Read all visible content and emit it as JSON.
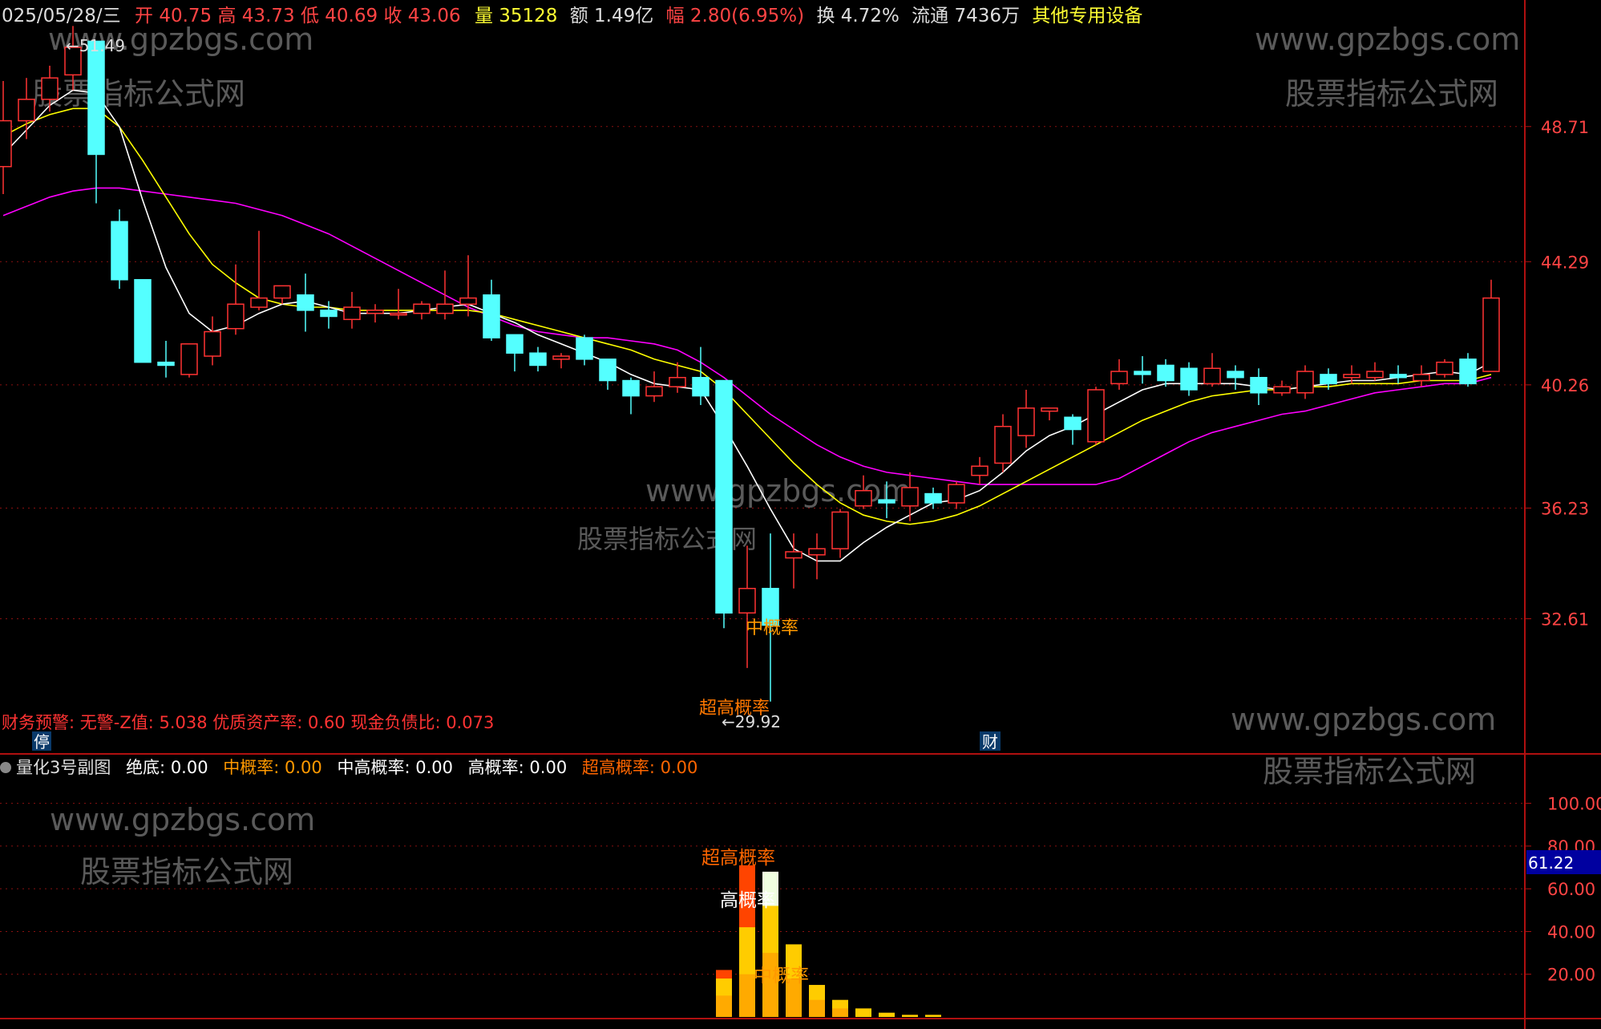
{
  "header": {
    "date": "025/05/28/三",
    "open_label": "开",
    "open": "40.75",
    "high_label": "高",
    "high": "43.73",
    "low_label": "低",
    "low": "40.69",
    "close_label": "收",
    "close": "43.06",
    "volume_label": "量",
    "volume": "35128",
    "amount_label": "额",
    "amount": "1.49亿",
    "change_label": "幅",
    "change": "2.80(6.95%)",
    "turnover_label": "换",
    "turnover": "4.72%",
    "float_label": "流通",
    "float": "7436万",
    "industry": "其他专用设备"
  },
  "watermarks": {
    "url": "www.gpzbgs.com",
    "cn": "股票指标公式网",
    "center_url": "www.gpzbgs.com",
    "center_cn": "股票指标公式网"
  },
  "main": {
    "max_label": "51.49",
    "min_label": "29.92",
    "finance_warning": "财务预警: 无警-Z值: 5.038 优质资产率: 0.60 现金负债比: 0.073",
    "tag_stop": "停",
    "tag_finance": "财",
    "annotation_mid": "中概率",
    "annotation_super": "超高概率"
  },
  "sub": {
    "title": "量化3号副图",
    "legend": [
      {
        "label": "绝底: 0.00",
        "color": "#ffffff"
      },
      {
        "label": "中概率: 0.00",
        "color": "#ff9900"
      },
      {
        "label": "中高概率: 0.00",
        "color": "#ffffff"
      },
      {
        "label": "高概率: 0.00",
        "color": "#ffffff"
      },
      {
        "label": "超高概率: 0.00",
        "color": "#ff6600"
      }
    ],
    "annotation_super": "超高概率",
    "annotation_high": "高概率",
    "annotation_mid": "中概率",
    "current_value": "61.22"
  },
  "chart_data": [
    {
      "type": "candlestick",
      "price_axis_ticks": [
        48.71,
        44.29,
        40.26,
        36.23,
        32.61
      ],
      "y_range": [
        29.5,
        51.8
      ],
      "moving_average_colors": {
        "ma_fast": "#ffffff",
        "ma_mid": "#ffff00",
        "ma_slow": "#ff00ff"
      },
      "up_color": "#ff3333",
      "down_color": "#54ffff",
      "candles": [
        [
          47.4,
          48.9,
          46.5,
          50.2
        ],
        [
          48.9,
          49.6,
          48.3,
          50.3
        ],
        [
          49.6,
          50.3,
          49.2,
          50.7
        ],
        [
          50.4,
          51.3,
          49.9,
          52.0
        ],
        [
          51.5,
          47.8,
          46.2,
          51.5
        ],
        [
          45.6,
          43.7,
          43.4,
          46.0
        ],
        [
          43.7,
          41.0,
          41.0,
          43.7
        ],
        [
          41.0,
          40.9,
          40.5,
          41.7
        ],
        [
          40.6,
          41.6,
          40.5,
          41.6
        ],
        [
          41.2,
          42.0,
          40.9,
          42.5
        ],
        [
          42.1,
          42.9,
          41.9,
          44.2
        ],
        [
          42.8,
          43.1,
          42.7,
          45.3
        ],
        [
          43.1,
          43.5,
          42.9,
          43.5
        ],
        [
          43.2,
          42.7,
          42.0,
          43.9
        ],
        [
          42.7,
          42.5,
          42.1,
          43.0
        ],
        [
          42.4,
          42.8,
          42.1,
          43.3
        ],
        [
          42.6,
          42.7,
          42.3,
          42.9
        ],
        [
          42.6,
          42.6,
          42.4,
          43.4
        ],
        [
          42.6,
          42.9,
          42.4,
          43.0
        ],
        [
          42.6,
          42.9,
          42.4,
          44.0
        ],
        [
          42.9,
          43.1,
          42.5,
          44.5
        ],
        [
          43.2,
          41.8,
          41.7,
          43.7
        ],
        [
          41.9,
          41.3,
          40.7,
          41.9
        ],
        [
          41.3,
          40.9,
          40.7,
          41.5
        ],
        [
          41.1,
          41.2,
          40.8,
          41.3
        ],
        [
          41.8,
          41.1,
          40.9,
          41.9
        ],
        [
          41.1,
          40.4,
          40.1,
          41.1
        ],
        [
          40.4,
          39.9,
          39.3,
          40.5
        ],
        [
          39.9,
          40.2,
          39.7,
          40.7
        ],
        [
          40.2,
          40.5,
          40.0,
          41.0
        ],
        [
          40.5,
          39.9,
          39.6,
          41.5
        ],
        [
          40.4,
          32.8,
          32.3,
          40.4
        ],
        [
          32.8,
          33.6,
          31.0,
          35.0
        ],
        [
          33.6,
          32.4,
          29.9,
          35.4
        ],
        [
          34.6,
          34.8,
          33.6,
          35.4
        ],
        [
          34.7,
          34.9,
          33.9,
          35.4
        ],
        [
          34.9,
          36.1,
          34.6,
          36.2
        ],
        [
          36.3,
          36.8,
          36.2,
          37.3
        ],
        [
          36.5,
          36.4,
          35.9,
          37.1
        ],
        [
          36.3,
          36.9,
          35.8,
          37.4
        ],
        [
          36.7,
          36.4,
          36.2,
          36.9
        ],
        [
          36.4,
          37.0,
          36.2,
          37.1
        ],
        [
          37.3,
          37.6,
          37.0,
          37.9
        ],
        [
          37.7,
          38.9,
          37.4,
          39.3
        ],
        [
          38.6,
          39.5,
          38.2,
          40.1
        ],
        [
          39.4,
          39.5,
          39.1,
          39.5
        ],
        [
          39.2,
          38.8,
          38.3,
          39.3
        ],
        [
          38.4,
          40.1,
          38.3,
          40.2
        ],
        [
          40.3,
          40.7,
          40.1,
          41.1
        ],
        [
          40.7,
          40.6,
          40.3,
          41.2
        ],
        [
          40.9,
          40.4,
          40.2,
          41.1
        ],
        [
          40.8,
          40.1,
          39.9,
          41.0
        ],
        [
          40.3,
          40.8,
          40.2,
          41.3
        ],
        [
          40.7,
          40.5,
          40.1,
          40.9
        ],
        [
          40.5,
          40.0,
          39.6,
          40.8
        ],
        [
          40.0,
          40.2,
          39.9,
          40.4
        ],
        [
          40.0,
          40.7,
          39.8,
          40.9
        ],
        [
          40.6,
          40.3,
          40.1,
          40.8
        ],
        [
          40.5,
          40.6,
          40.3,
          40.9
        ],
        [
          40.5,
          40.7,
          40.4,
          41.0
        ],
        [
          40.6,
          40.5,
          40.3,
          40.9
        ],
        [
          40.4,
          40.6,
          40.2,
          40.9
        ],
        [
          40.6,
          41.0,
          40.5,
          41.1
        ],
        [
          41.1,
          40.3,
          40.2,
          41.3
        ],
        [
          40.7,
          43.1,
          40.7,
          43.7
        ]
      ],
      "ma_fast": [
        47.8,
        48.6,
        49.4,
        49.9,
        49.8,
        48.7,
        46.3,
        44.1,
        42.6,
        42.0,
        42.2,
        42.6,
        42.9,
        43.0,
        42.8,
        42.6,
        42.6,
        42.6,
        42.7,
        42.8,
        42.9,
        42.6,
        42.3,
        41.9,
        41.6,
        41.3,
        41.0,
        40.6,
        40.3,
        40.2,
        40.1,
        38.9,
        37.6,
        36.2,
        34.9,
        34.5,
        34.5,
        35.1,
        35.6,
        36.0,
        36.4,
        36.5,
        36.8,
        37.4,
        38.1,
        38.6,
        38.9,
        39.3,
        39.7,
        40.1,
        40.3,
        40.3,
        40.3,
        40.3,
        40.2,
        40.1,
        40.2,
        40.3,
        40.4,
        40.4,
        40.5,
        40.6,
        40.7,
        40.6,
        41.0
      ],
      "ma_mid": [
        48.4,
        48.8,
        49.1,
        49.3,
        49.3,
        48.7,
        47.6,
        46.4,
        45.2,
        44.2,
        43.6,
        43.1,
        42.9,
        42.8,
        42.8,
        42.7,
        42.7,
        42.7,
        42.7,
        42.7,
        42.7,
        42.6,
        42.4,
        42.2,
        42.0,
        41.8,
        41.6,
        41.4,
        41.1,
        40.9,
        40.7,
        40.1,
        39.3,
        38.5,
        37.7,
        37.0,
        36.4,
        36.0,
        35.8,
        35.7,
        35.8,
        36.0,
        36.3,
        36.7,
        37.1,
        37.5,
        37.9,
        38.3,
        38.7,
        39.1,
        39.4,
        39.7,
        39.9,
        40.0,
        40.1,
        40.1,
        40.2,
        40.2,
        40.3,
        40.3,
        40.3,
        40.4,
        40.4,
        40.4,
        40.6
      ],
      "ma_slow": [
        45.8,
        46.1,
        46.4,
        46.6,
        46.7,
        46.7,
        46.6,
        46.5,
        46.4,
        46.3,
        46.2,
        46.0,
        45.8,
        45.5,
        45.2,
        44.8,
        44.4,
        44.0,
        43.6,
        43.2,
        42.8,
        42.5,
        42.2,
        42.0,
        41.9,
        41.8,
        41.8,
        41.7,
        41.6,
        41.4,
        41.0,
        40.5,
        39.9,
        39.3,
        38.8,
        38.3,
        37.9,
        37.6,
        37.4,
        37.3,
        37.2,
        37.1,
        37.0,
        37.0,
        37.0,
        37.0,
        37.0,
        37.0,
        37.2,
        37.6,
        38.0,
        38.4,
        38.7,
        38.9,
        39.1,
        39.3,
        39.4,
        39.6,
        39.8,
        40.0,
        40.1,
        40.2,
        40.3,
        40.3,
        40.5
      ]
    },
    {
      "type": "bar",
      "y_axis_ticks": [
        100.0,
        80.0,
        60.0,
        40.0,
        20.0
      ],
      "y_range": [
        0,
        110
      ],
      "series_colors": {
        "super_high": "#ff4400",
        "high": "#f0ffe0",
        "mid_high": "#ffcc00",
        "mid": "#ffaa00"
      },
      "bars": [
        {
          "x": 31,
          "super_high": 22,
          "mid_high": 18,
          "mid": 10
        },
        {
          "x": 32,
          "super_high": 71,
          "mid_high": 42,
          "mid": 20
        },
        {
          "x": 33,
          "high": 68,
          "mid_high": 52,
          "mid": 30
        },
        {
          "x": 34,
          "mid_high": 34,
          "mid": 18
        },
        {
          "x": 35,
          "mid_high": 15,
          "mid": 8
        },
        {
          "x": 36,
          "mid_high": 8,
          "mid": 4
        },
        {
          "x": 37,
          "mid_high": 4
        },
        {
          "x": 38,
          "mid_high": 2
        },
        {
          "x": 39,
          "mid_high": 1
        },
        {
          "x": 40,
          "mid_high": 1
        }
      ]
    }
  ]
}
